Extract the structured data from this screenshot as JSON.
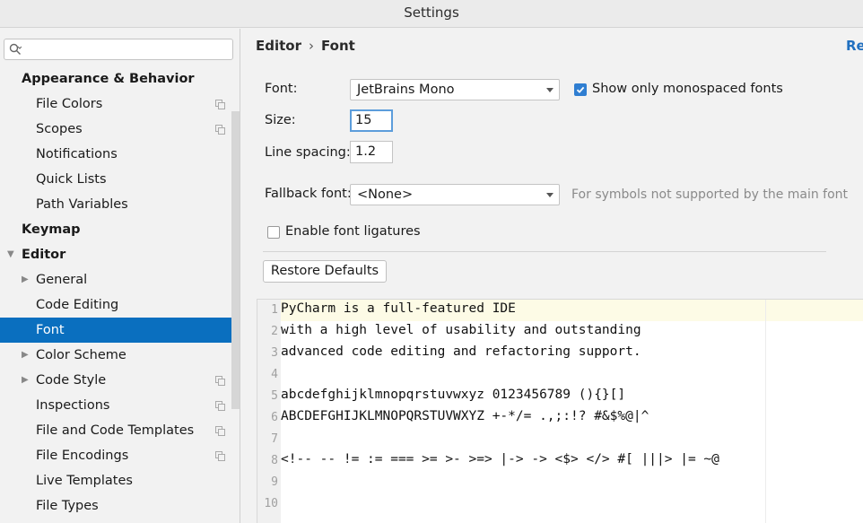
{
  "window": {
    "title": "Settings"
  },
  "sidebar": {
    "search": {
      "placeholder": "",
      "icon": "search-icon"
    },
    "items": [
      {
        "label": "Appearance & Behavior",
        "level": 0,
        "expandable": false,
        "copy": false
      },
      {
        "label": "File Colors",
        "level": 1,
        "expandable": false,
        "copy": true
      },
      {
        "label": "Scopes",
        "level": 1,
        "expandable": false,
        "copy": true
      },
      {
        "label": "Notifications",
        "level": 1,
        "expandable": false,
        "copy": false
      },
      {
        "label": "Quick Lists",
        "level": 1,
        "expandable": false,
        "copy": false
      },
      {
        "label": "Path Variables",
        "level": 1,
        "expandable": false,
        "copy": false
      },
      {
        "label": "Keymap",
        "level": 0,
        "expandable": false,
        "copy": false
      },
      {
        "label": "Editor",
        "level": 0,
        "expandable": true,
        "expanded": true,
        "copy": false
      },
      {
        "label": "General",
        "level": 1,
        "expandable": true,
        "copy": false
      },
      {
        "label": "Code Editing",
        "level": 1,
        "expandable": false,
        "copy": false
      },
      {
        "label": "Font",
        "level": 1,
        "expandable": false,
        "copy": false,
        "selected": true
      },
      {
        "label": "Color Scheme",
        "level": 1,
        "expandable": true,
        "copy": false
      },
      {
        "label": "Code Style",
        "level": 1,
        "expandable": true,
        "copy": true
      },
      {
        "label": "Inspections",
        "level": 1,
        "expandable": false,
        "copy": true
      },
      {
        "label": "File and Code Templates",
        "level": 1,
        "expandable": false,
        "copy": true
      },
      {
        "label": "File Encodings",
        "level": 1,
        "expandable": false,
        "copy": true
      },
      {
        "label": "Live Templates",
        "level": 1,
        "expandable": false,
        "copy": false
      },
      {
        "label": "File Types",
        "level": 1,
        "expandable": false,
        "copy": false
      }
    ]
  },
  "header": {
    "breadcrumb": [
      "Editor",
      "Font"
    ],
    "separator": "›",
    "reset_link": "Res"
  },
  "font_settings": {
    "font_label": "Font:",
    "font_value": "JetBrains Mono",
    "monospaced_checked": true,
    "monospaced_label": "Show only monospaced fonts",
    "size_label": "Size:",
    "size_value": "15",
    "line_spacing_label": "Line spacing:",
    "line_spacing_value": "1.2",
    "fallback_label": "Fallback font:",
    "fallback_value": "<None>",
    "fallback_hint": "For symbols not supported by the main font",
    "ligatures_checked": false,
    "ligatures_label": "Enable font ligatures",
    "restore_button": "Restore Defaults"
  },
  "preview": {
    "lines": [
      "PyCharm is a full-featured IDE",
      "with a high level of usability and outstanding",
      "advanced code editing and refactoring support.",
      "",
      "abcdefghijklmnopqrstuvwxyz 0123456789 (){}[]",
      "ABCDEFGHIJKLMNOPQRSTUVWXYZ +-*/= .,;:!? #&$%@|^",
      "",
      "<!-- -- != := === >= >- >=> |-> -> <$> </> #[ |||> |= ~@",
      "",
      ""
    ]
  },
  "colors": {
    "selection": "#0a6fbf",
    "link": "#2170c0",
    "checkbox": "#2f7ed1",
    "focus_border": "#5c9ddb",
    "current_line": "#fdfbe6"
  }
}
